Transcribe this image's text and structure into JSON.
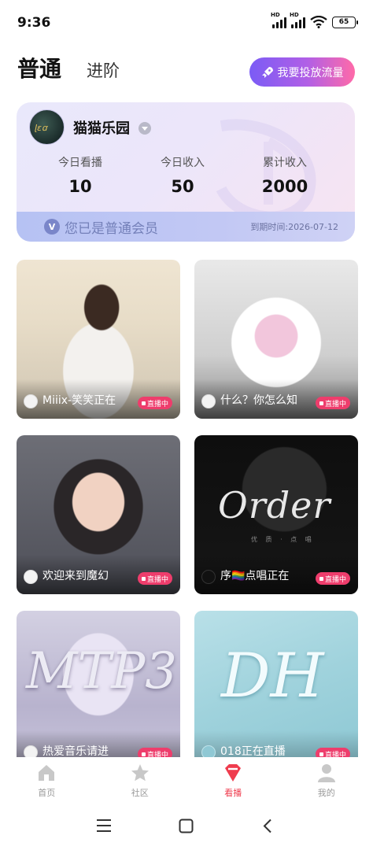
{
  "status_bar": {
    "time": "9:36",
    "hd1": "HD",
    "hd2": "HD",
    "battery": "65"
  },
  "header": {
    "tab_active": "普通",
    "tab_inactive": "进阶",
    "promo_button": "我要投放流量"
  },
  "member_card": {
    "name": "猫猫乐园",
    "stats": [
      {
        "label": "今日看播",
        "value": "10"
      },
      {
        "label": "今日收入",
        "value": "50"
      },
      {
        "label": "累计收入",
        "value": "2000"
      }
    ],
    "member_status": "您已是普通会员",
    "expiry": "到期时间:2026-07-12"
  },
  "live_rooms": [
    {
      "title": "Miiix-笑笑正在",
      "badge": "直播中"
    },
    {
      "title": "什么？你怎么知",
      "badge": "直播中"
    },
    {
      "title": "欢迎来到魔幻",
      "badge": "直播中"
    },
    {
      "title": "序🏳️‍🌈点唱正在",
      "badge": "直播中",
      "cover_text": "Order",
      "cover_small": "优 质 · 点 唱"
    },
    {
      "title": "热爱音乐请进",
      "badge": "直播中",
      "cover_text": "MTP3"
    },
    {
      "title": "018正在直播",
      "badge": "直播中",
      "cover_text": "DH"
    }
  ],
  "bottom_nav": [
    {
      "label": "首页",
      "icon": "home-icon"
    },
    {
      "label": "社区",
      "icon": "star-icon"
    },
    {
      "label": "看播",
      "icon": "watch-gem-icon",
      "active": true
    },
    {
      "label": "我的",
      "icon": "profile-icon"
    }
  ],
  "colors": {
    "accent": "#ef3c4e",
    "live_badge": "#ee3d6c",
    "promo_start": "#7b5cf5",
    "promo_end": "#ff6aa8"
  }
}
